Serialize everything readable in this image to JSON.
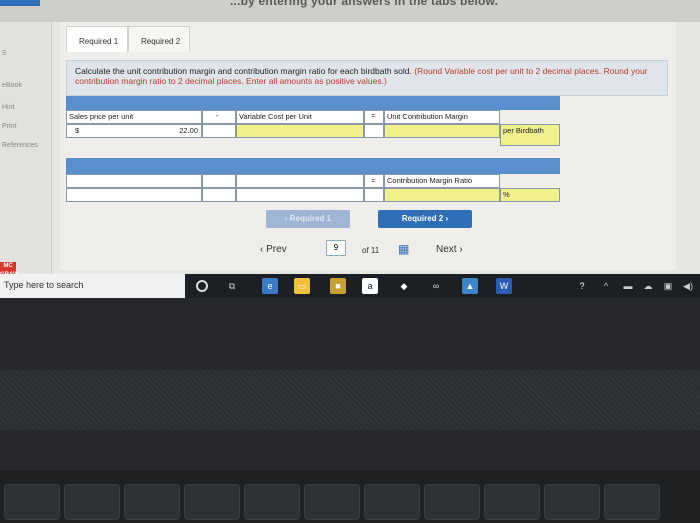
{
  "window": {
    "title_partial": "...by entering your answers in the tabs below."
  },
  "leftnav": {
    "items": [
      "eBook",
      "Hint",
      "Print",
      "References"
    ],
    "letter": "s",
    "brand": "McGraw Hill"
  },
  "tabs": [
    {
      "label": "Required 1",
      "active": true
    },
    {
      "label": "Required 2",
      "active": false
    }
  ],
  "instructions": {
    "text": "Calculate the unit contribution margin and contribution margin ratio for each birdbath sold.",
    "red": "(Round Variable cost per unit to 2 decimal places. Round your contribution margin ratio to 2 decimal places. Enter all amounts as positive values.)"
  },
  "table1": {
    "col1_label": "Sales price per unit",
    "col1_symbol": "$",
    "col1_value": "22.00",
    "op1": "-",
    "col2_label": "Variable Cost per Unit",
    "op2": "=",
    "col3_label": "Unit Contribution Margin",
    "unit_label": "per Birdbath"
  },
  "table2": {
    "op": "=",
    "col_label": "Contribution Margin Ratio",
    "unit_label": "%"
  },
  "pager": {
    "prev_label": "Required 1",
    "next_label": "Required 2"
  },
  "nav": {
    "prev": "Prev",
    "page": "9",
    "of": "of 11",
    "next": "Next"
  },
  "taskbar": {
    "search_placeholder": "Type here to search"
  },
  "colors": {
    "header_blue": "#5a8fd0",
    "answer_yellow": "#f2f08a",
    "accent": "#2f6fb5"
  }
}
